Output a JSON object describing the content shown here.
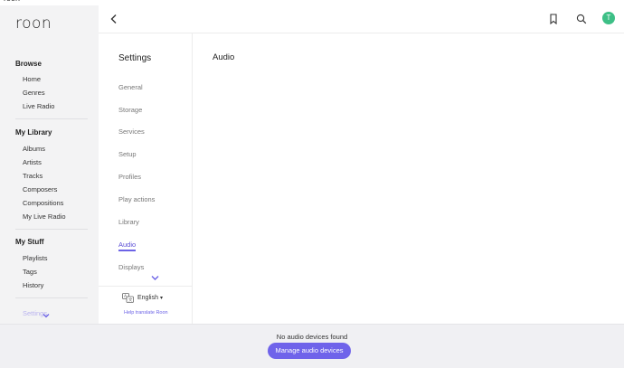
{
  "window": {
    "title": "roon",
    "minimize": "—",
    "close": "✕"
  },
  "app": {
    "logo_text": "roon"
  },
  "sidebar": {
    "browse": {
      "title": "Browse",
      "items": [
        "Home",
        "Genres",
        "Live Radio"
      ]
    },
    "library": {
      "title": "My Library",
      "items": [
        "Albums",
        "Artists",
        "Tracks",
        "Composers",
        "Compositions",
        "My Live Radio"
      ]
    },
    "stuff": {
      "title": "My Stuff",
      "items": [
        "Playlists",
        "Tags",
        "History"
      ]
    },
    "settings_label": "Settings"
  },
  "topbar": {
    "icons": [
      "back-arrow-icon",
      "bookmark-icon",
      "search-icon"
    ],
    "avatar_initial": "T",
    "avatar_color": "#3dbf86"
  },
  "settings": {
    "title": "Settings",
    "items": [
      "General",
      "Storage",
      "Services",
      "Setup",
      "Profiles",
      "Play actions",
      "Library",
      "Audio",
      "Displays"
    ],
    "active_item": "Audio",
    "language": "English",
    "help_link": "Help translate Roon"
  },
  "main": {
    "title": "Audio"
  },
  "bottom": {
    "message": "No audio devices found",
    "button_label": "Manage audio devices"
  },
  "colors": {
    "accent": "#6f63ea",
    "sidebar_bg": "#f3f3f4",
    "bottom_bg": "#f0f0f3"
  }
}
